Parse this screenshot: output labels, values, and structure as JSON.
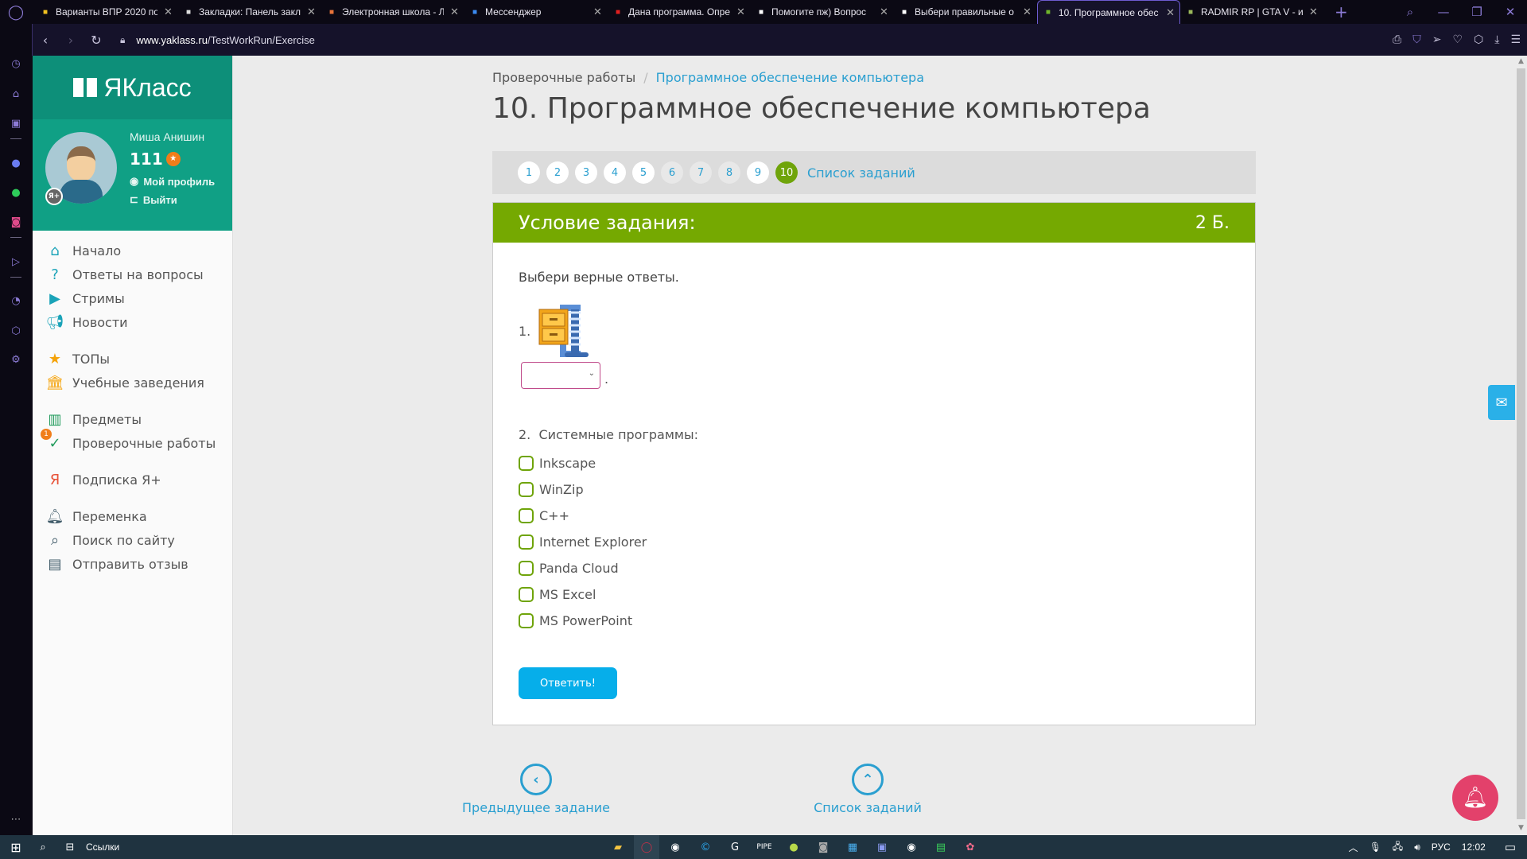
{
  "browser": {
    "tabs": [
      {
        "title": "Варианты ВПР 2020 по",
        "favicon": "lamp-icon",
        "color": "#f0c020"
      },
      {
        "title": "Закладки: Панель закл",
        "favicon": "heart-icon",
        "color": "#dddddd"
      },
      {
        "title": "Электронная школа - Л",
        "favicon": "school-icon",
        "color": "#e8743a"
      },
      {
        "title": "Мессенджер",
        "favicon": "messenger-icon",
        "color": "#3b8af0"
      },
      {
        "title": "Дана программа. Опре",
        "favicon": "yandex-icon",
        "color": "#e02020"
      },
      {
        "title": "Помогите пж) Вопрос",
        "favicon": "znanija-icon",
        "color": "#ffffff"
      },
      {
        "title": "Выбери правильные о",
        "favicon": "znanija-icon",
        "color": "#ffffff"
      },
      {
        "title": "10. Программное обес",
        "favicon": "yaklass-icon",
        "color": "#6fb52c",
        "active": true
      },
      {
        "title": "RADMIR RP | GTA V - иг",
        "favicon": "radmir-icon",
        "color": "#9ab85a"
      }
    ],
    "url_domain": "www.yaklass.ru",
    "url_path": "/TestWorkRun/Exercise"
  },
  "site": {
    "logo": "ЯКласс",
    "user": {
      "name": "Миша Анишин",
      "points": "111",
      "profile_link": "Мой профиль",
      "logout_link": "Выйти",
      "badge": "Я+"
    },
    "menu": [
      {
        "label": "Начало",
        "icon": "home-icon",
        "color": "#1aa3b8"
      },
      {
        "label": "Ответы на вопросы",
        "icon": "question-icon",
        "color": "#1aa3b8"
      },
      {
        "label": "Стримы",
        "icon": "play-icon",
        "color": "#1aa3b8"
      },
      {
        "label": "Новости",
        "icon": "megaphone-icon",
        "color": "#1aa3b8"
      },
      {
        "label": "ТОПы",
        "icon": "star-icon",
        "color": "#f5a30a"
      },
      {
        "label": "Учебные заведения",
        "icon": "institution-icon",
        "color": "#f5a30a"
      },
      {
        "label": "Предметы",
        "icon": "books-icon",
        "color": "#1f9a5a"
      },
      {
        "label": "Проверочные работы",
        "icon": "check-icon",
        "color": "#1f9a5a",
        "badge": "1"
      },
      {
        "label": "Подписка Я+",
        "icon": "ya-plus-icon",
        "color": "#e8543a"
      },
      {
        "label": "Переменка",
        "icon": "bell-icon",
        "color": "#3f5a68"
      },
      {
        "label": "Поиск по сайту",
        "icon": "search-icon",
        "color": "#3f5a68"
      },
      {
        "label": "Отправить отзыв",
        "icon": "feedback-icon",
        "color": "#3f5a68"
      }
    ]
  },
  "main": {
    "breadcrumb": {
      "parent": "Проверочные работы",
      "current": "Программное обеспечение компьютера"
    },
    "title": "10. Программное обеспечение компьютера",
    "pager": {
      "pages": [
        {
          "n": "1",
          "state": "unvisited"
        },
        {
          "n": "2",
          "state": "unvisited"
        },
        {
          "n": "3",
          "state": "unvisited"
        },
        {
          "n": "4",
          "state": "unvisited"
        },
        {
          "n": "5",
          "state": "unvisited"
        },
        {
          "n": "6",
          "state": "done"
        },
        {
          "n": "7",
          "state": "done"
        },
        {
          "n": "8",
          "state": "done"
        },
        {
          "n": "9",
          "state": "unvisited"
        },
        {
          "n": "10",
          "state": "current"
        }
      ],
      "list_link": "Список заданий"
    },
    "card": {
      "heading": "Условие задания:",
      "points": "2 Б.",
      "instruction": "Выбери верные ответы.",
      "q1_number": "1.",
      "q1_image": "winzip-icon",
      "q1_select_value": "",
      "q1_suffix": ".",
      "q2_label": "2.  Системные программы:",
      "options": [
        "Inkscape",
        "WinZip",
        "C++",
        "Internet Explorer",
        "Panda Cloud",
        "MS Excel",
        "MS PowerPoint"
      ],
      "submit": "Ответить!"
    },
    "bottom_nav": {
      "prev": "Предыдущее задание",
      "list": "Список заданий"
    }
  },
  "taskbar": {
    "search_label": "Ссылки",
    "lang": "РУС",
    "time": "12:02"
  }
}
